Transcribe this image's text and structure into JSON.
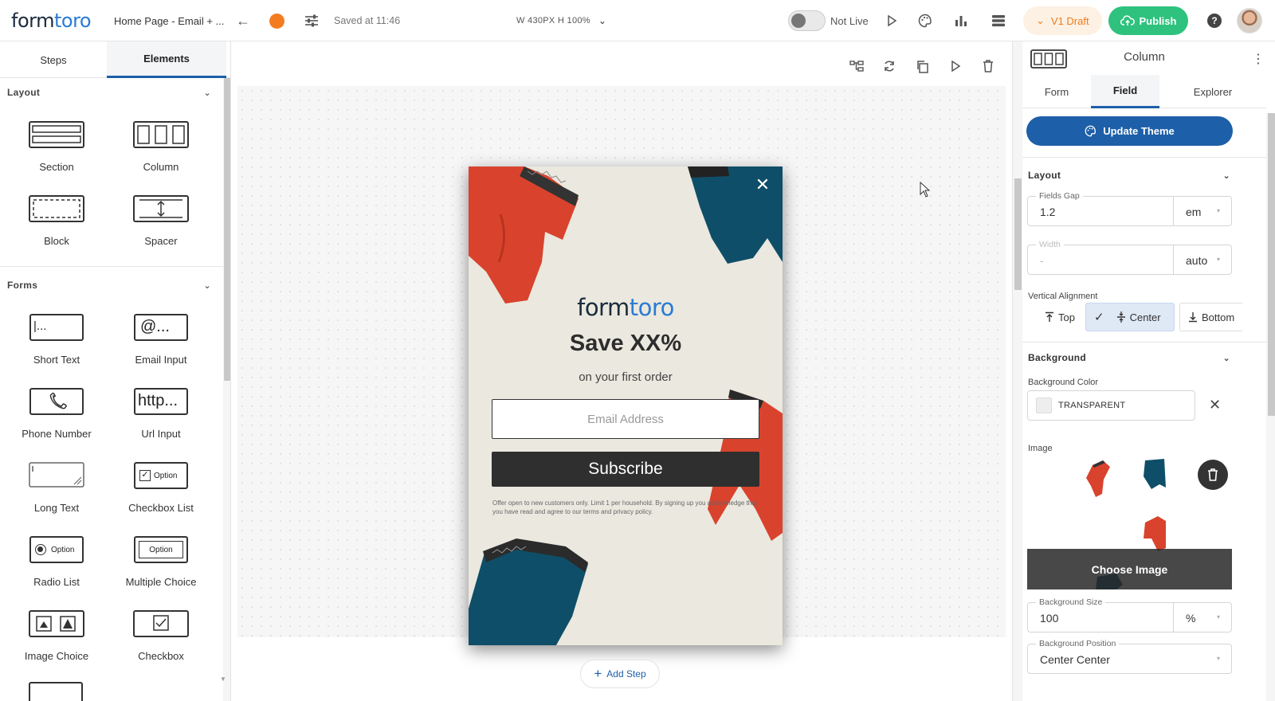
{
  "topbar": {
    "logo_a": "form",
    "logo_b": "toro",
    "page_name": "Home Page - Email + ...",
    "saved": "Saved at 11:46",
    "dims": "W 430PX  H 100%",
    "live_status": "Not Live",
    "draft_label": "V1 Draft",
    "publish_label": "Publish",
    "help": "?",
    "colors": {
      "orange": "#f47c20",
      "publish_green": "#2ec27e",
      "draft_orange": "#ef7a1a"
    }
  },
  "left": {
    "tabs": [
      "Steps",
      "Elements"
    ],
    "active_tab": "Elements",
    "layout_title": "Layout",
    "forms_title": "Forms",
    "layout_items": [
      "Section",
      "Column",
      "Block",
      "Spacer"
    ],
    "form_items": [
      "Short Text",
      "Email Input",
      "Phone Number",
      "Url Input",
      "Long Text",
      "Checkbox List",
      "Radio List",
      "Multiple Choice",
      "Image Choice",
      "Checkbox"
    ],
    "icon_texts": {
      "short_text": "|...",
      "email": "@...",
      "url": "http...",
      "option": "Option"
    }
  },
  "canvas": {
    "popup": {
      "logo_a": "form",
      "logo_b": "toro",
      "headline": "Save XX%",
      "subheadline": "on your first order",
      "email_placeholder": "Email Address",
      "button": "Subscribe",
      "fine_print": "Offer open to new customers only. Limit 1 per household. By signing up you acknowledge that you have read and agree to our terms and privacy policy.",
      "colors": {
        "bg": "#ebe8df",
        "red": "#d9432d",
        "blue": "#0f4e68",
        "button": "#2f2f2f"
      }
    },
    "add_step": "Add Step"
  },
  "right": {
    "title": "Column",
    "tabs": [
      "Form",
      "Field",
      "Explorer"
    ],
    "active_tab": "Field",
    "update_theme": "Update Theme",
    "layout_title": "Layout",
    "fields_gap_label": "Fields Gap",
    "fields_gap_value": "1.2",
    "fields_gap_unit": "em",
    "width_label": "Width",
    "width_value": "-",
    "width_unit": "auto",
    "valign_label": "Vertical Alignment",
    "valign_top": "Top",
    "valign_center": "Center",
    "valign_bottom": "Bottom",
    "background_title": "Background",
    "bg_color_label": "Background Color",
    "bg_color_value": "TRANSPARENT",
    "image_label": "Image",
    "choose_image": "Choose Image",
    "bg_size_label": "Background Size",
    "bg_size_value": "100",
    "bg_size_unit": "%",
    "bg_pos_label": "Background Position",
    "bg_pos_value": "Center Center",
    "accent": "#1d5fa8"
  }
}
